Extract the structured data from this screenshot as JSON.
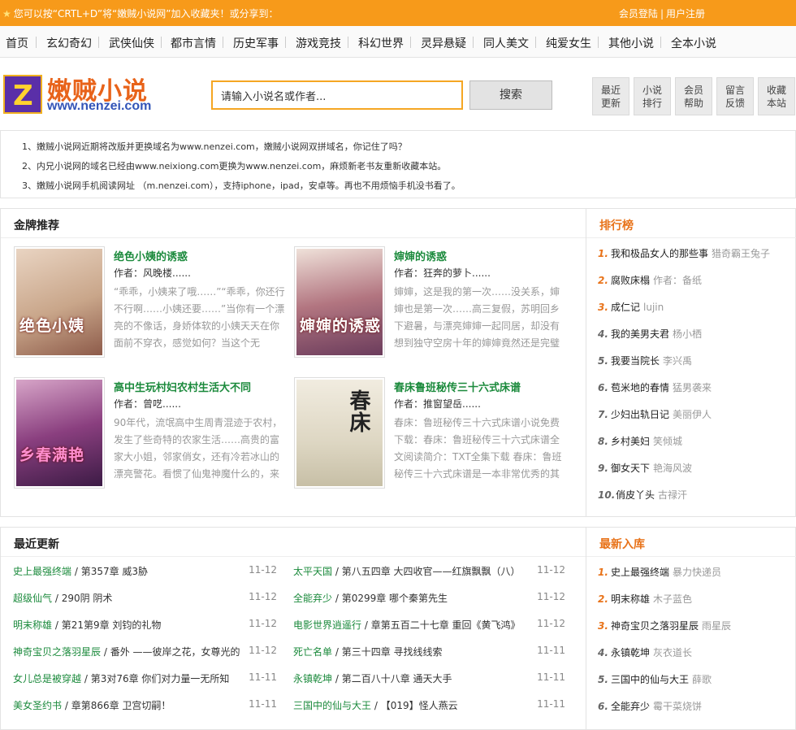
{
  "topbar": {
    "message": "您可以按“CRTL+D”将“嫩贼小说网”加入收藏夹！或分享到：",
    "login": "会员登陆",
    "register": "用户注册"
  },
  "nav": [
    "首页",
    "玄幻奇幻",
    "武侠仙侠",
    "都市言情",
    "历史军事",
    "游戏竞技",
    "科幻世界",
    "灵异悬疑",
    "同人美文",
    "纯爱女生",
    "其他小说",
    "全本小说"
  ],
  "logo": {
    "cn": "嫩贼小说",
    "en": "www.nenzei.com",
    "mark": "Z"
  },
  "search": {
    "placeholder": "请输入小说名或作者...",
    "button": "搜索"
  },
  "quick": [
    {
      "l1": "最近",
      "l2": "更新"
    },
    {
      "l1": "小说",
      "l2": "排行"
    },
    {
      "l1": "会员",
      "l2": "帮助"
    },
    {
      "l1": "留言",
      "l2": "反馈"
    },
    {
      "l1": "收藏",
      "l2": "本站"
    }
  ],
  "notices": [
    "1、嫩贼小说网近期将改版并更换域名为www.nenzei.com，嫩贼小说网双拼域名，你记住了吗？",
    "2、内兄小说网的域名已经由www.neixiong.com更换为www.nenzei.com，麻烦新老书友重新收藏本站。",
    "3、嫩贼小说网手机阅读网址 （m.nenzei.com），支持iphone，ipad，安卓等。再也不用烦恼手机没书看了。"
  ],
  "featured": {
    "title": "金牌推荐",
    "books": [
      {
        "title": "绝色小姨的诱惑",
        "author": "作者：风晚楼......",
        "desc": "“乖乖，小姨来了哦……”“乖乖，你还行不行啊……小姨还要……”当你有一个漂亮的不像话，身娇体软的小姨天天在你面前不穿衣，感觉如何？当这个无",
        "cover_text": "绝色小姨",
        "cover_color": "#c9a68a"
      },
      {
        "title": "婶婶的诱惑",
        "author": "作者：狂奔的萝卜......",
        "desc": "婶婶，这是我的第一次……没关系，婶婶也是第一次……高三复假，苏明回乡下避暑，与漂亮婶婶一起同居，却没有想到独守空房十年的婶婶竟然还是完璧",
        "cover_text": "婶婶的诱惑",
        "cover_color": "#b27580"
      },
      {
        "title": "高中生玩村妇农村生活大不同",
        "author": "作者：曾呓......",
        "desc": "90年代，流氓高中生周青混迹于农村，发生了些奇特的农家生活……高贵的富家大小姐，邻家俏女，还有冷若冰山的漂亮警花。看惯了仙鬼神魔什么的，来",
        "cover_text": "乡春满艳",
        "cover_color": "#8a3f7f"
      },
      {
        "title": "春床鲁班秘传三十六式床谱",
        "author": "作者：推窗望岳......",
        "desc": "春床：鲁班秘传三十六式床谱小说免费下载：春床：鲁班秘传三十六式床谱全文阅读简介：TXT全集下载 春床：鲁班秘传三十六式床谱是一本非常优秀的其",
        "cover_text": "春床",
        "cover_color": "#ddd6c2"
      }
    ]
  },
  "ranking": {
    "title": "排行榜",
    "items": [
      {
        "num": "1.",
        "name": "我和极品女人的那些事",
        "author": "猎奇霸王兔子"
      },
      {
        "num": "2.",
        "name": "腐败床榻",
        "author": "作者：备纸"
      },
      {
        "num": "3.",
        "name": "成仁记",
        "author": "lujin"
      },
      {
        "num": "4.",
        "name": "我的美男夫君",
        "author": "杨小栖"
      },
      {
        "num": "5.",
        "name": "我要当院长",
        "author": "李兴禹"
      },
      {
        "num": "6.",
        "name": "苞米地的春情",
        "author": "猛男袭来"
      },
      {
        "num": "7.",
        "name": "少妇出轨日记",
        "author": "美丽伊人"
      },
      {
        "num": "8.",
        "name": "乡村美妇",
        "author": "笑倾城"
      },
      {
        "num": "9.",
        "name": "御女天下",
        "author": "艳海风波"
      },
      {
        "num": "10.",
        "name": "俏皮丫头",
        "author": "古禄汗"
      }
    ]
  },
  "updates": {
    "title": "最近更新",
    "left": [
      {
        "title": "史上最强终端",
        "chapter": "第357章 威3胁",
        "date": "11-12"
      },
      {
        "title": "超级仙气",
        "chapter": "290阴 阴术",
        "date": "11-12"
      },
      {
        "title": "明末称雄",
        "chapter": "第21第9章 刘钧的礼物",
        "date": "11-12"
      },
      {
        "title": "神奇宝贝之落羽星辰",
        "chapter": "番外 ——彼岸之花，女尊光的",
        "date": "11-12"
      },
      {
        "title": "女儿总是被穿越",
        "chapter": "第3对76章 你们对力量一无所知",
        "date": "11-11"
      },
      {
        "title": "美女圣约书",
        "chapter": "章第866章 卫宫切嗣！",
        "date": "11-11"
      }
    ],
    "right": [
      {
        "title": "太平天国",
        "chapter": "第八五四章 大四收官——红旗飘飘（八）",
        "date": "11-12"
      },
      {
        "title": "全能弃少",
        "chapter": "第0299章 哪个秦第先生",
        "date": "11-12"
      },
      {
        "title": "电影世界逍遥行",
        "chapter": "章第五百二十七章 重回《黄飞鸿》",
        "date": "11-12"
      },
      {
        "title": "死亡名单",
        "chapter": "第三十四章 寻找线线索",
        "date": "11-11"
      },
      {
        "title": "永镇乾坤",
        "chapter": "第二百八十八章 通天大手",
        "date": "11-11"
      },
      {
        "title": "三国中的仙与大王",
        "chapter": "【019】怪人燕云",
        "date": "11-11"
      }
    ]
  },
  "newbooks": {
    "title": "最新入库",
    "items": [
      {
        "num": "1.",
        "name": "史上最强终端",
        "author": "暴力快递员"
      },
      {
        "num": "2.",
        "name": "明末称雄",
        "author": "木子蓝色"
      },
      {
        "num": "3.",
        "name": "神奇宝贝之落羽星辰",
        "author": "雨星辰"
      },
      {
        "num": "4.",
        "name": "永镇乾坤",
        "author": "灰衣道长"
      },
      {
        "num": "5.",
        "name": "三国中的仙与大王",
        "author": "薛歌"
      },
      {
        "num": "6.",
        "name": "全能弃少",
        "author": "霉干菜烧饼"
      }
    ]
  },
  "colors": {
    "accent": "#f79a1a",
    "link_green": "#1b8a3c",
    "rank_orange": "#e8731a"
  }
}
